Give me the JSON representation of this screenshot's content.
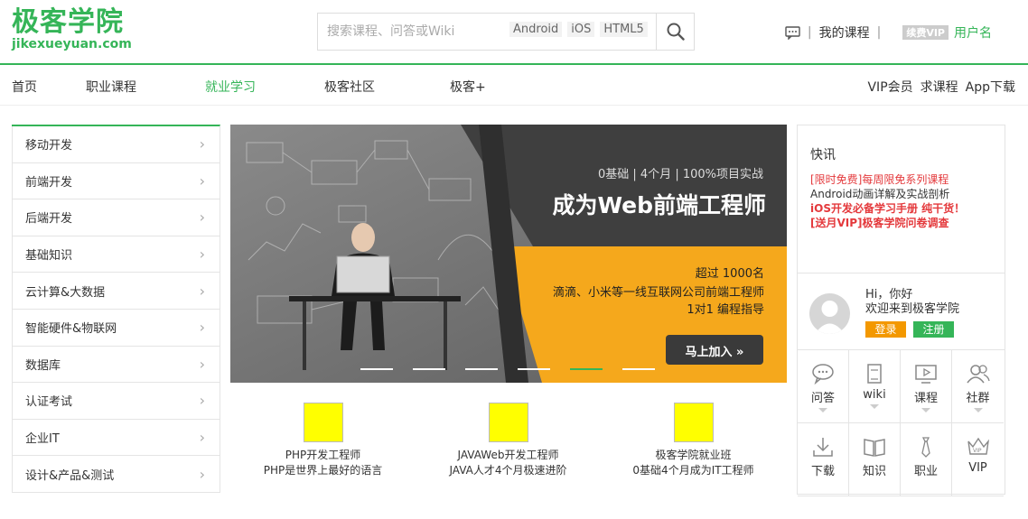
{
  "logo": {
    "cn": "极客学院",
    "en": "jikexueyuan.com"
  },
  "search": {
    "placeholder": "搜索课程、问答或Wiki",
    "hot_tags": [
      "Android",
      "iOS",
      "HTML5"
    ],
    "icon": "search-icon"
  },
  "userbar": {
    "message_icon": "message-icon",
    "my_courses": "我的课程",
    "vip_badge": "续费VIP",
    "username": "用户名"
  },
  "nav": {
    "items": [
      "首页",
      "职业课程",
      "就业学习",
      "极客社区",
      "极客+"
    ],
    "active_index": 2,
    "right": [
      "VIP会员",
      "求课程",
      "App下载"
    ]
  },
  "sidebar": {
    "items": [
      "移动开发",
      "前端开发",
      "后端开发",
      "基础知识",
      "云计算&大数据",
      "智能硬件&物联网",
      "数据库",
      "认证考试",
      "企业IT",
      "设计&产品&测试"
    ]
  },
  "banner": {
    "subtitle": "0基础 | 4个月 | 100%项目实战",
    "title": "成为Web前端工程师",
    "line1": "超过 1000名",
    "line2": "滴滴、小米等一线互联网公司前端工程师",
    "line3": "1对1 编程指导",
    "cta": "马上加入 »",
    "slide_count": 6,
    "active_slide": 4
  },
  "courses": [
    {
      "title": "PHP开发工程师",
      "desc": "PHP是世界上最好的语言"
    },
    {
      "title": "JAVAWeb开发工程师",
      "desc": "JAVA人才4个月极速进阶"
    },
    {
      "title": "极客学院就业班",
      "desc": "0基础4个月成为IT工程师"
    }
  ],
  "news": {
    "title": "快讯",
    "items": [
      {
        "text": "[限时免费]每周限免系列课程",
        "color": "#e4393c",
        "bold": false
      },
      {
        "text": "Android动画详解及实战剖析",
        "color": "#333333",
        "bold": false
      },
      {
        "text": "iOS开发必备学习手册 纯干货！",
        "color": "#e4393c",
        "bold": true
      },
      {
        "text": "[送月VIP]极客学院问卷调查",
        "color": "#e4393c",
        "bold": true
      }
    ]
  },
  "welcome": {
    "greeting": "Hi，你好",
    "message": "欢迎来到极客学院",
    "login": "登录",
    "register": "注册"
  },
  "quick_links": [
    {
      "label": "问答",
      "icon": "qa-icon",
      "has_arrow": true
    },
    {
      "label": "wiki",
      "icon": "wiki-icon",
      "has_arrow": true
    },
    {
      "label": "课程",
      "icon": "course-icon",
      "has_arrow": true
    },
    {
      "label": "社群",
      "icon": "community-icon",
      "has_arrow": true
    },
    {
      "label": "下载",
      "icon": "download-icon",
      "has_arrow": false
    },
    {
      "label": "知识",
      "icon": "knowledge-icon",
      "has_arrow": false
    },
    {
      "label": "职业",
      "icon": "career-icon",
      "has_arrow": false
    },
    {
      "label": "VIP",
      "icon": "vip-icon",
      "has_arrow": false
    }
  ],
  "colors": {
    "brand": "#35b558",
    "orange": "#f5a623",
    "dark": "#3d3d3d"
  }
}
